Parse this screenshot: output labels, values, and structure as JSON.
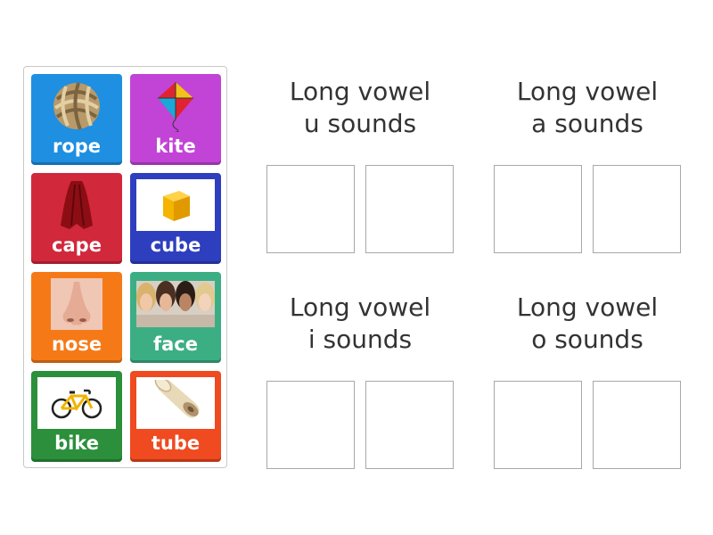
{
  "colors": {
    "blue": "#1e8fe1",
    "purple": "#c244d6",
    "red": "#d1283c",
    "navy": "#2d3fbf",
    "orange": "#f57a17",
    "teal": "#3cae83",
    "green": "#2b8f3b",
    "red_orange": "#ef4a20"
  },
  "tiles": [
    {
      "label": "rope",
      "icon": "rope-knot-icon",
      "color": "blue"
    },
    {
      "label": "kite",
      "icon": "kite-icon",
      "color": "purple"
    },
    {
      "label": "cape",
      "icon": "cape-icon",
      "color": "red"
    },
    {
      "label": "cube",
      "icon": "cube-icon",
      "color": "navy"
    },
    {
      "label": "nose",
      "icon": "nose-icon",
      "color": "orange"
    },
    {
      "label": "face",
      "icon": "faces-icon",
      "color": "teal"
    },
    {
      "label": "bike",
      "icon": "bicycle-icon",
      "color": "green"
    },
    {
      "label": "tube",
      "icon": "tube-icon",
      "color": "red_orange"
    }
  ],
  "groups": [
    {
      "line1": "Long vowel",
      "line2": "u sounds"
    },
    {
      "line1": "Long vowel",
      "line2": "a sounds"
    },
    {
      "line1": "Long vowel",
      "line2": "i sounds"
    },
    {
      "line1": "Long vowel",
      "line2": "o sounds"
    }
  ]
}
